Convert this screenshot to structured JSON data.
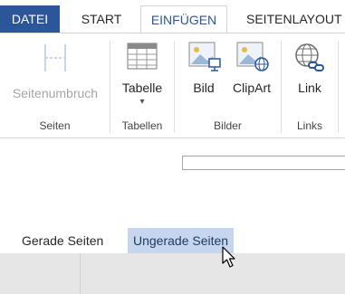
{
  "tabs": {
    "file": "DATEI",
    "start": "START",
    "insert": "EINFÜGEN",
    "layout": "SEITENLAYOUT"
  },
  "ribbon": {
    "pages": {
      "group_label": "Seiten",
      "page_break": "Seitenumbruch"
    },
    "tables": {
      "group_label": "Tabellen",
      "table": "Tabelle",
      "dropdown": "▾"
    },
    "pictures": {
      "group_label": "Bilder",
      "picture": "Bild",
      "clipart": "ClipArt"
    },
    "links": {
      "group_label": "Links",
      "link": "Link"
    }
  },
  "document": {
    "even_pages": "Gerade Seiten",
    "odd_pages": "Ungerade Seiten"
  },
  "colors": {
    "accent": "#2b579a",
    "selection": "#c5d6ee"
  }
}
